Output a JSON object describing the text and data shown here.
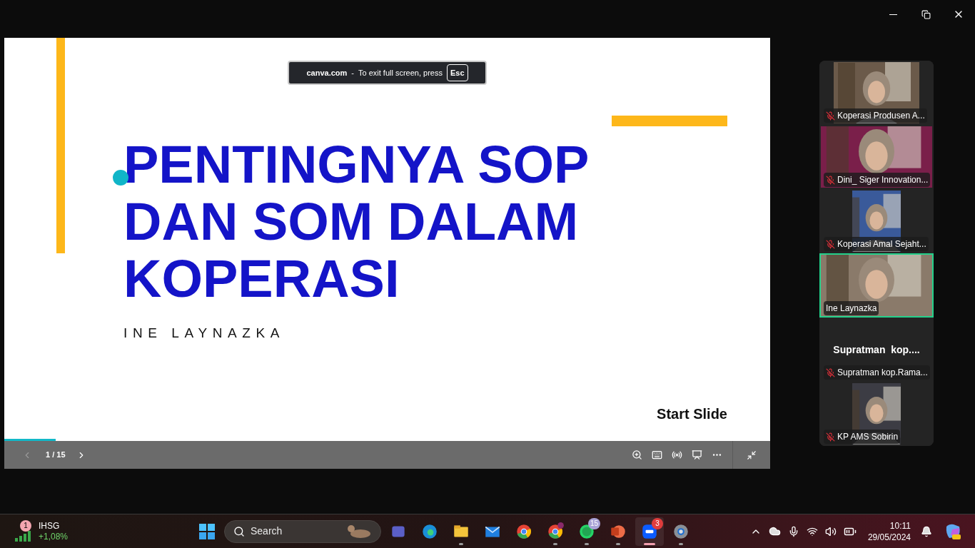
{
  "slide": {
    "title": "PENTINGNYA SOP DAN SOM DALAM KOPERASI",
    "speaker": "INE LAYNAZKA",
    "start_label": "Start Slide",
    "progress": {
      "level": 0.067
    },
    "banner": {
      "site": "canva.com",
      "separator": "-",
      "message": "To exit full screen, press",
      "key": "Esc"
    }
  },
  "slide_controls": {
    "page": "1 / 15",
    "prev_disabled": true
  },
  "participants": [
    {
      "name": "Koperasi Produsen A...",
      "muted": true,
      "kind": "narrow",
      "active": false
    },
    {
      "name": "Dini_ Siger Innovation...",
      "muted": true,
      "kind": "wide",
      "active": false
    },
    {
      "name": "Koperasi Amal Sejaht...",
      "muted": true,
      "kind": "small",
      "active": false
    },
    {
      "name": "Ine Laynazka",
      "muted": false,
      "kind": "wide",
      "active": true
    },
    {
      "name": "Supratman kop.Rama...",
      "muted": true,
      "kind": "avatar",
      "active": false,
      "display_name": "Supratman  kop...."
    },
    {
      "name": "KP AMS Sobirin",
      "muted": true,
      "kind": "small",
      "active": false
    }
  ],
  "taskbar": {
    "widget": {
      "title": "IHSG",
      "change": "+1,08%",
      "badge": "1"
    },
    "search_placeholder": "Search",
    "apps": [
      {
        "kind": "teams",
        "running": false,
        "active": false
      },
      {
        "kind": "edge",
        "running": false,
        "active": false
      },
      {
        "kind": "explorer",
        "running": true,
        "active": false
      },
      {
        "kind": "mail",
        "running": false,
        "active": false
      },
      {
        "kind": "chrome",
        "running": false,
        "active": false
      },
      {
        "kind": "chrome-profile",
        "running": true,
        "active": false
      },
      {
        "kind": "whatsapp",
        "running": true,
        "active": false,
        "badge": "15"
      },
      {
        "kind": "powerpoint",
        "running": true,
        "active": false
      },
      {
        "kind": "zoom",
        "running": true,
        "active": true,
        "badge": "3"
      },
      {
        "kind": "settings",
        "running": true,
        "active": false
      }
    ],
    "time": "10:11",
    "date": "29/05/2024"
  }
}
